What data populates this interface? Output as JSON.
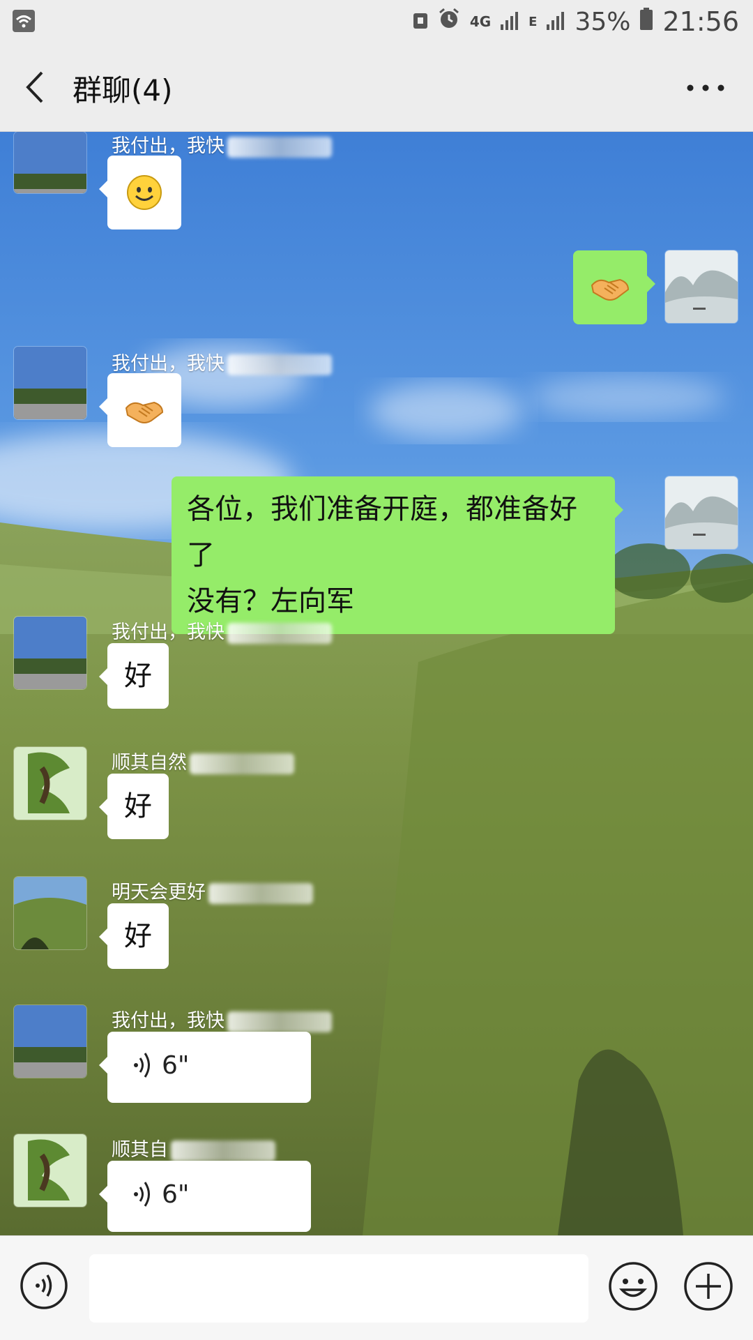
{
  "status_bar": {
    "network": "4G",
    "signal2": "E",
    "battery": "35%",
    "time": "21:56"
  },
  "header": {
    "title": "群聊(4)"
  },
  "messages": [
    {
      "side": "left",
      "sender": "我付出，我快",
      "type": "emoji",
      "emoji": "smile-emoji"
    },
    {
      "side": "right",
      "type": "emoji",
      "emoji": "handshake-emoji"
    },
    {
      "side": "left",
      "sender": "我付出，我快",
      "type": "emoji",
      "emoji": "handshake-emoji"
    },
    {
      "side": "right",
      "type": "text",
      "text_line1": "各位，我们准备开庭，都准备好了",
      "text_line2": "没有？左向军"
    },
    {
      "side": "left",
      "sender": "我付出，我快",
      "type": "text",
      "text": "好"
    },
    {
      "side": "left",
      "sender": "顺其自然",
      "type": "text",
      "text": "好"
    },
    {
      "side": "left",
      "sender": "明天会更好",
      "type": "text",
      "text": "好"
    },
    {
      "side": "left",
      "sender": "我付出，我快",
      "type": "voice",
      "duration": "6\""
    },
    {
      "side": "left",
      "sender": "顺其自",
      "type": "voice",
      "duration": "6\""
    }
  ],
  "input_bar": {
    "placeholder": ""
  },
  "colors": {
    "sent_bubble": "#95ec69",
    "received_bubble": "#ffffff",
    "toolbar": "#ededed"
  }
}
